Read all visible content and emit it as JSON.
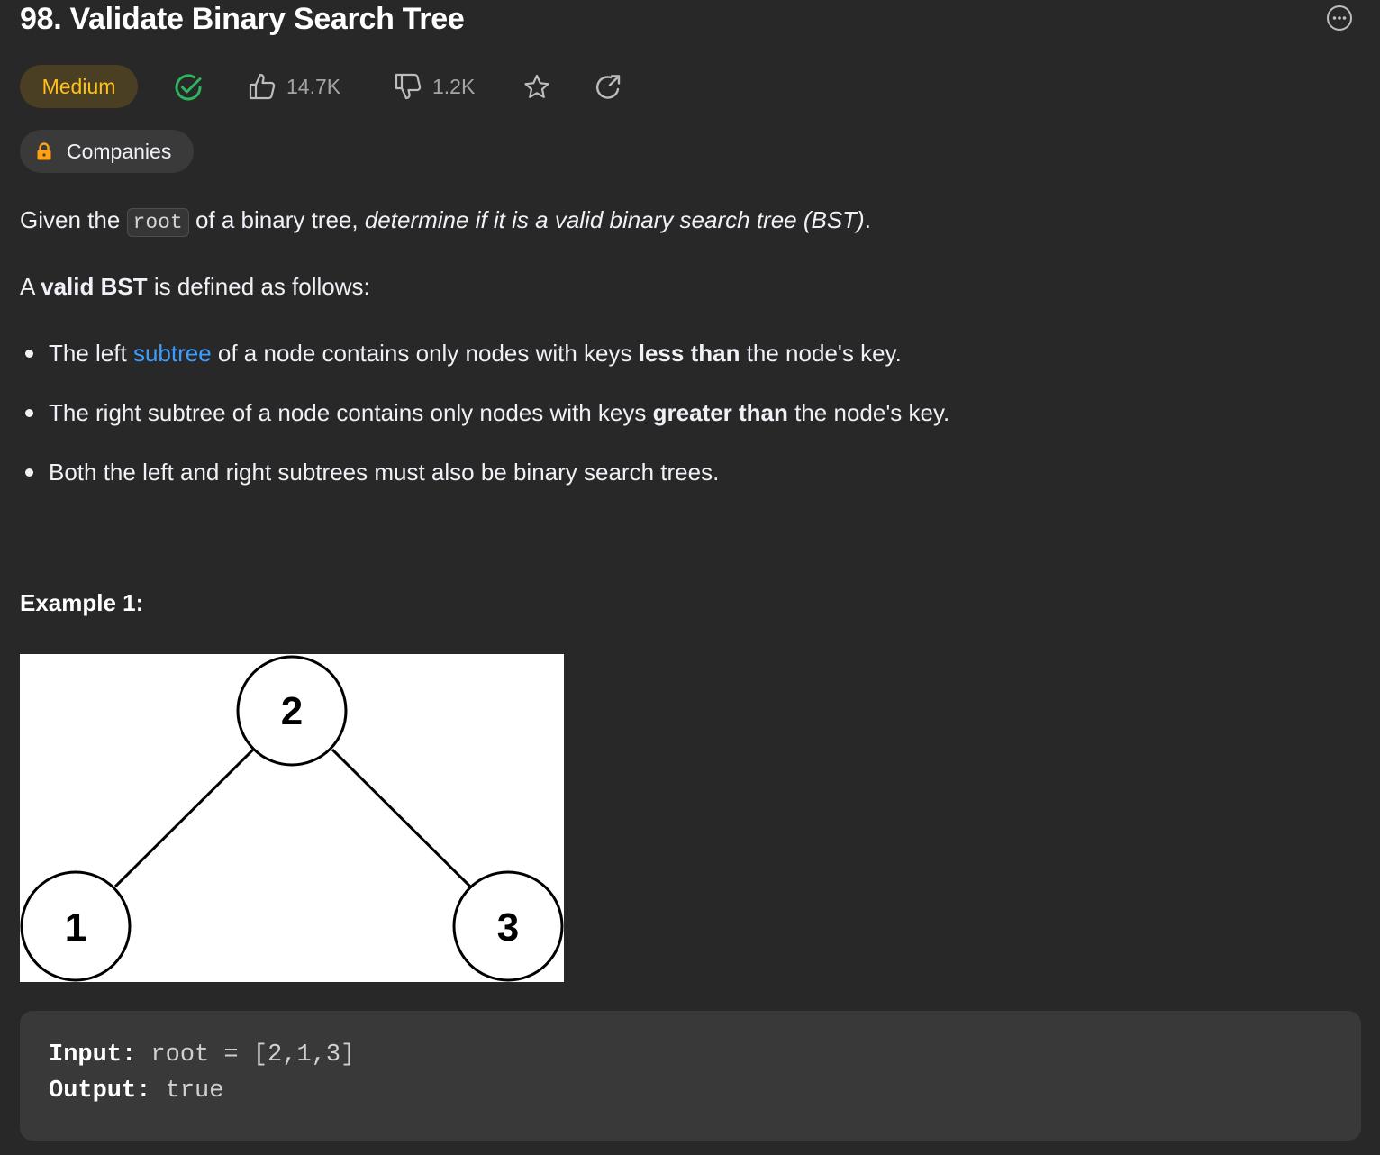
{
  "problem": {
    "title": "98. Validate Binary Search Tree",
    "difficulty": "Medium",
    "likes": "14.7K",
    "dislikes": "1.2K",
    "companies_label": "Companies"
  },
  "colors": {
    "difficulty_medium": "#ffc01e",
    "solved_green": "#2db55d",
    "link_blue": "#3c9dff",
    "lock_orange": "#ffa116"
  },
  "icons": {
    "solved": "check-circle-icon",
    "like": "thumbs-up-icon",
    "dislike": "thumbs-down-icon",
    "favorite": "star-icon",
    "share": "share-icon",
    "more": "more-options-icon",
    "companies": "lock-icon"
  },
  "description": {
    "intro_prefix": "Given the ",
    "intro_code": "root",
    "intro_middle": " of a binary tree, ",
    "intro_emphasis": "determine if it is a valid binary search tree (BST)",
    "intro_suffix": ".",
    "def_prefix": "A ",
    "def_bold": "valid BST",
    "def_suffix": " is defined as follows:",
    "rules": [
      {
        "pre": "The left ",
        "link": "subtree",
        "mid": " of a node contains only nodes with keys ",
        "bold": "less than",
        "post": " the node's key."
      },
      {
        "pre": "The right subtree of a node contains only nodes with keys ",
        "bold": "greater than",
        "post": " the node's key."
      },
      {
        "text": "Both the left and right subtrees must also be binary search trees."
      }
    ]
  },
  "example1": {
    "heading": "Example 1:",
    "tree_nodes": [
      "2",
      "1",
      "3"
    ],
    "input_label": "Input:",
    "input_value": "root = [2,1,3]",
    "output_label": "Output:",
    "output_value": "true"
  }
}
